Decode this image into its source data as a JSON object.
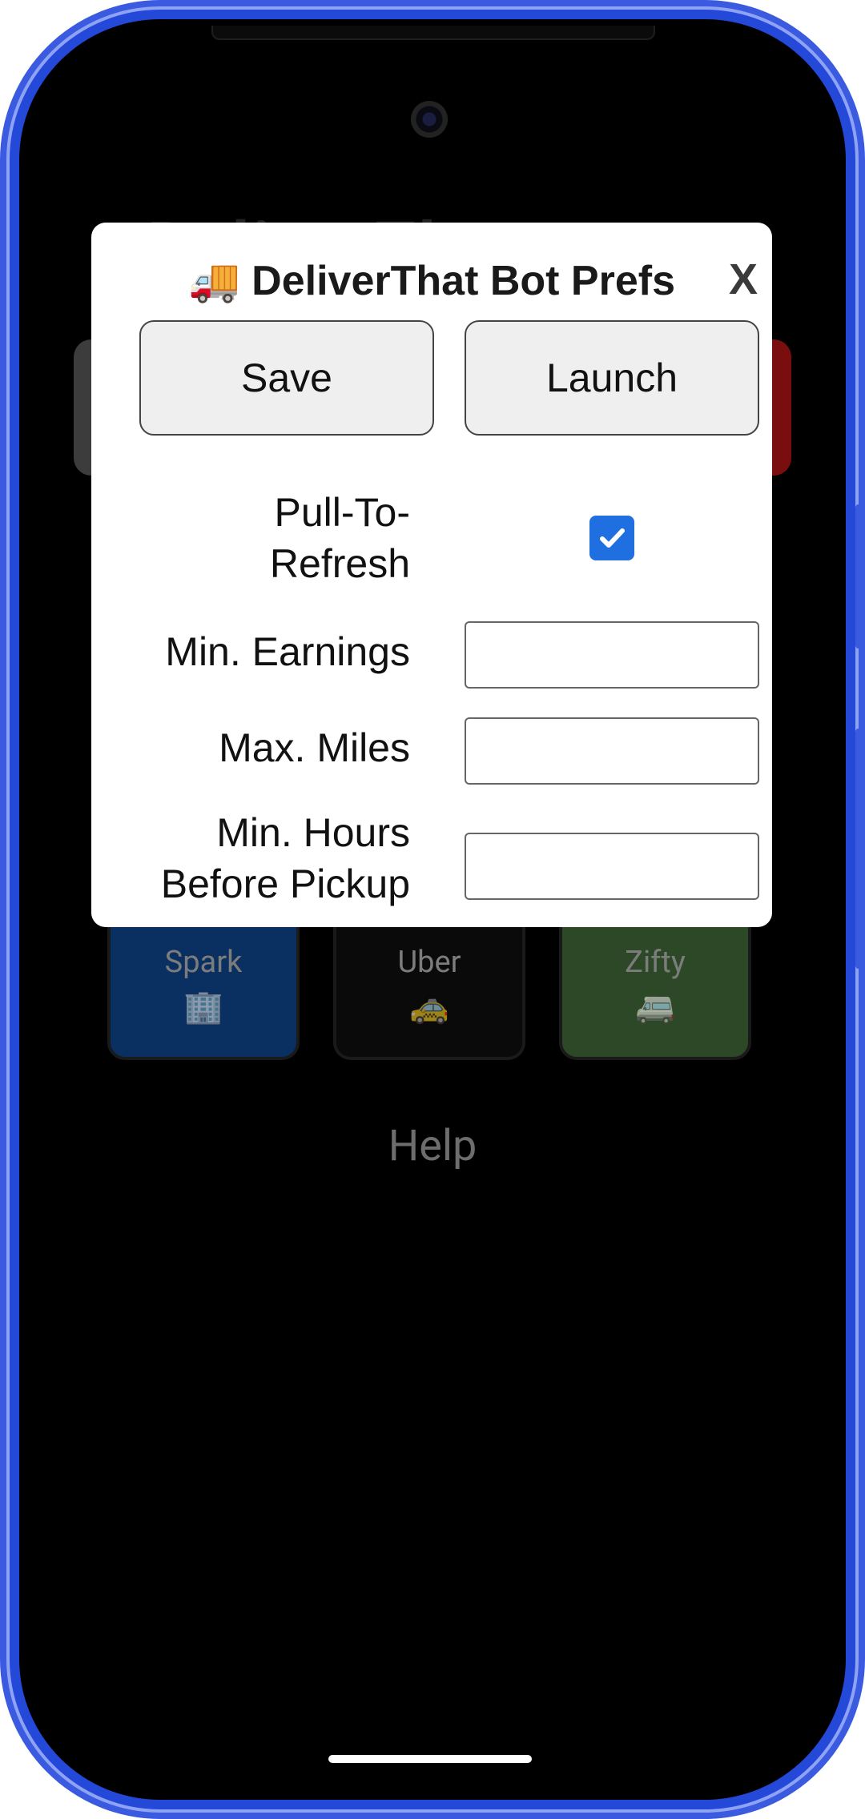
{
  "background": {
    "logo_text": "DeliverThat",
    "tiles": [
      {
        "label": "Spark",
        "icon": "🏢",
        "color": "#0a2f61"
      },
      {
        "label": "Uber",
        "icon": "🚕",
        "color": "#0a0a0a"
      },
      {
        "label": "Zifty",
        "icon": "🚐",
        "color": "#2d4827"
      }
    ],
    "help_label": "Help"
  },
  "dialog": {
    "title": "🚚 DeliverThat Bot Prefs",
    "close_label": "X",
    "save_label": "Save",
    "launch_label": "Launch",
    "pull_to_refresh": {
      "label_line1": "Pull-To-",
      "label_line2": "Refresh",
      "checked": true
    },
    "min_earnings": {
      "label": "Min. Earnings",
      "value": ""
    },
    "max_miles": {
      "label": "Max. Miles",
      "value": ""
    },
    "min_hours": {
      "label_line1": "Min. Hours",
      "label_line2": "Before Pickup",
      "value": ""
    }
  },
  "colors": {
    "frame": "#3a5be0",
    "checkbox": "#1f6fe0"
  }
}
